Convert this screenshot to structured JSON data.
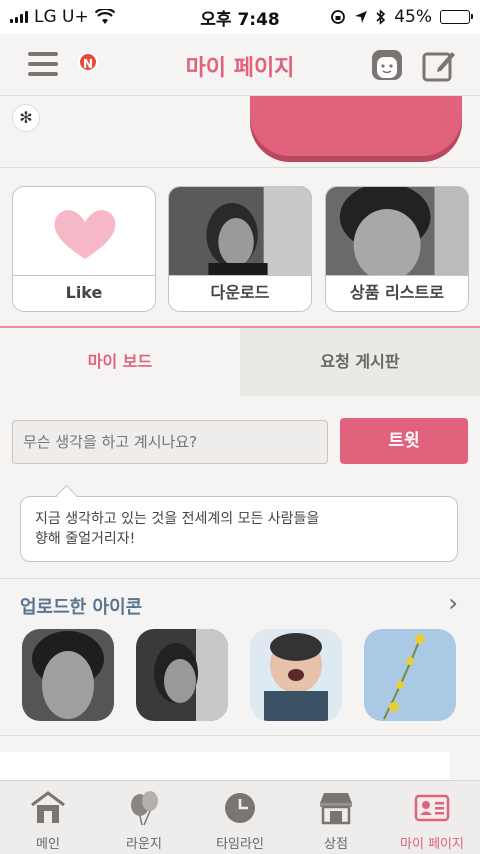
{
  "status": {
    "carrier": "LG U+",
    "time": "오후 7:48",
    "battery": "45%",
    "battery_level": 0.45
  },
  "header": {
    "title": "마이 페이지",
    "notification_badge": "N"
  },
  "cards": [
    {
      "label": "Like"
    },
    {
      "label": "다운로드"
    },
    {
      "label": "상품 리스트로"
    }
  ],
  "tabs": {
    "active": "마이 보드",
    "inactive": "요청 게시판"
  },
  "compose": {
    "placeholder": "무슨 생각을 하고 계시나요?",
    "button": "트윗"
  },
  "tooltip": {
    "line1": "지금 생각하고 있는 것을 전세계의 모든 사람들을",
    "line2": "향해 줄얼거리자!"
  },
  "uploaded": {
    "title": "업로드한 아이콘"
  },
  "nav": [
    {
      "label": "메인",
      "icon": "home-icon"
    },
    {
      "label": "라운지",
      "icon": "balloons-icon"
    },
    {
      "label": "타임라인",
      "icon": "clock-icon"
    },
    {
      "label": "상점",
      "icon": "store-icon"
    },
    {
      "label": "마이 페이지",
      "icon": "profile-card-icon"
    }
  ],
  "colors": {
    "accent": "#e0627c",
    "nav_bg": "#efedeb",
    "page_bg": "#f6f4f2"
  }
}
